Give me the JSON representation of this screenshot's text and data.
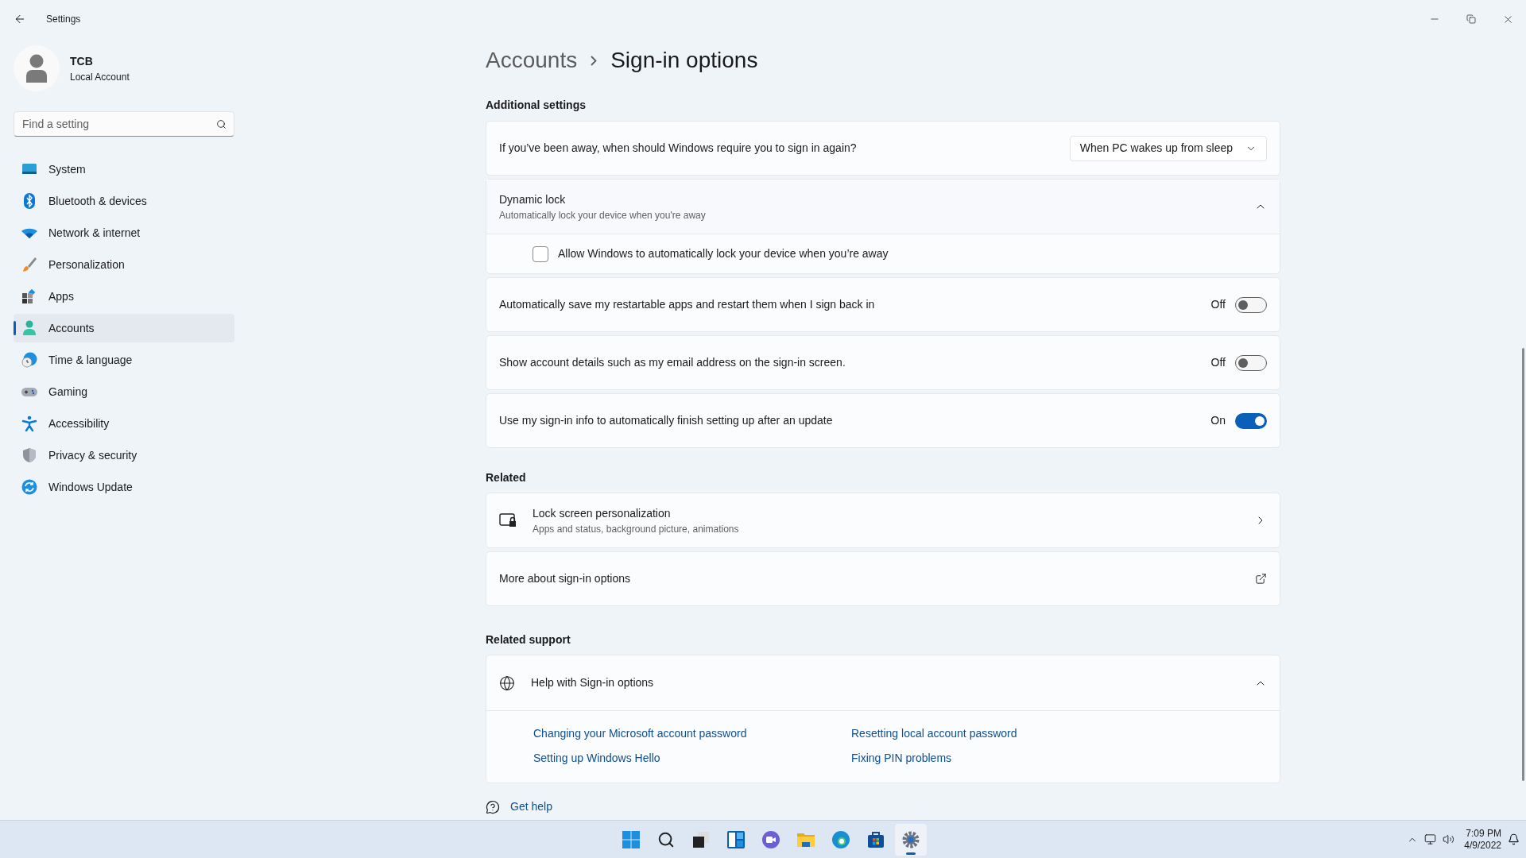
{
  "window": {
    "title": "Settings"
  },
  "account": {
    "name": "TCB",
    "type": "Local Account"
  },
  "search": {
    "placeholder": "Find a setting"
  },
  "nav": [
    {
      "label": "System",
      "selected": false
    },
    {
      "label": "Bluetooth & devices",
      "selected": false
    },
    {
      "label": "Network & internet",
      "selected": false
    },
    {
      "label": "Personalization",
      "selected": false
    },
    {
      "label": "Apps",
      "selected": false
    },
    {
      "label": "Accounts",
      "selected": true
    },
    {
      "label": "Time & language",
      "selected": false
    },
    {
      "label": "Gaming",
      "selected": false
    },
    {
      "label": "Accessibility",
      "selected": false
    },
    {
      "label": "Privacy & security",
      "selected": false
    },
    {
      "label": "Windows Update",
      "selected": false
    }
  ],
  "breadcrumb": {
    "parent": "Accounts",
    "current": "Sign-in options"
  },
  "additional_settings": {
    "heading": "Additional settings",
    "rows": [
      {
        "kind": "dropdown",
        "label": "If you’ve been away, when should Windows require you to sign in again?",
        "value": "When PC wakes up from sleep"
      },
      {
        "kind": "expander",
        "title": "Dynamic lock",
        "subtitle": "Automatically lock your device when you're away",
        "expanded": true,
        "option": {
          "label": "Allow Windows to automatically lock your device when you’re away",
          "checked": false
        }
      },
      {
        "kind": "toggle",
        "label": "Automatically save my restartable apps and restart them when I sign back in",
        "state_text": "Off",
        "on": false
      },
      {
        "kind": "toggle",
        "label": "Show account details such as my email address on the sign-in screen.",
        "state_text": "Off",
        "on": false
      },
      {
        "kind": "toggle",
        "label": "Use my sign-in info to automatically finish setting up after an update",
        "state_text": "On",
        "on": true
      }
    ]
  },
  "related": {
    "heading": "Related",
    "rows": [
      {
        "kind": "navigate",
        "title": "Lock screen personalization",
        "subtitle": "Apps and status, background picture, animations"
      },
      {
        "kind": "external",
        "title": "More about sign-in options"
      }
    ]
  },
  "related_support": {
    "heading": "Related support",
    "help": {
      "title": "Help with Sign-in options",
      "expanded": true,
      "links": [
        "Changing your Microsoft account password",
        "Resetting local account password",
        "Setting up Windows Hello",
        "Fixing PIN problems"
      ]
    }
  },
  "get_help": "Get help",
  "taskbar": {
    "apps": [
      {
        "selected": false
      },
      {
        "selected": false
      },
      {
        "selected": false
      },
      {
        "selected": false
      },
      {
        "selected": false
      },
      {
        "selected": false
      },
      {
        "selected": false
      },
      {
        "selected": false
      },
      {
        "selected": true
      }
    ],
    "time": "7:09 PM",
    "date": "4/9/2022"
  }
}
